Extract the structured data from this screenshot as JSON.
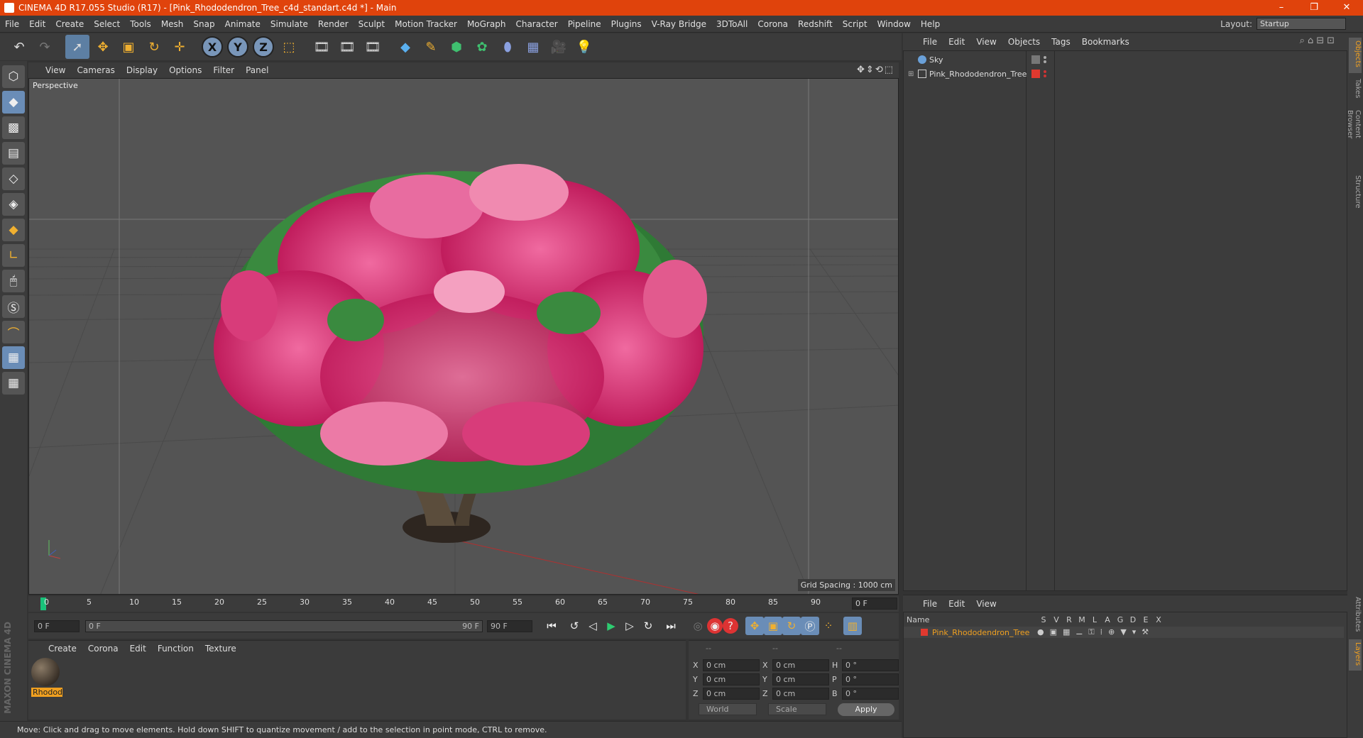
{
  "window": {
    "title": "CINEMA 4D R17.055 Studio (R17) - [Pink_Rhododendron_Tree_c4d_standart.c4d *] - Main",
    "buttons": [
      "–",
      "❐",
      "✕"
    ]
  },
  "menubar": {
    "items": [
      "File",
      "Edit",
      "Create",
      "Select",
      "Tools",
      "Mesh",
      "Snap",
      "Animate",
      "Simulate",
      "Render",
      "Sculpt",
      "Motion Tracker",
      "MoGraph",
      "Character",
      "Pipeline",
      "Plugins",
      "V-Ray Bridge",
      "3DToAll",
      "Corona",
      "Redshift",
      "Script",
      "Window",
      "Help"
    ],
    "layout_label": "Layout:",
    "layout_value": "Startup"
  },
  "toolbar": {
    "axis_x": "X",
    "axis_y": "Y",
    "axis_z": "Z",
    "icons": [
      "undo-icon",
      "redo-icon",
      "select-icon",
      "move-icon",
      "scale-icon",
      "rotate-icon",
      "last-tool-icon",
      "axis-x-icon",
      "axis-y-icon",
      "axis-z-icon",
      "coordinate-system-icon",
      "render-view-icon",
      "render-picture-viewer-icon",
      "edit-render-settings-icon",
      "cube-icon",
      "pen-icon",
      "subdivision-icon",
      "array-icon",
      "deformer-icon",
      "floor-icon",
      "camera-icon",
      "light-icon"
    ]
  },
  "viewport": {
    "menu": [
      "View",
      "Cameras",
      "Display",
      "Options",
      "Filter",
      "Panel"
    ],
    "label": "Perspective",
    "grid_spacing": "Grid Spacing : 1000 cm"
  },
  "timeline": {
    "ticks": [
      "0",
      "5",
      "10",
      "15",
      "20",
      "25",
      "30",
      "35",
      "40",
      "45",
      "50",
      "55",
      "60",
      "65",
      "70",
      "75",
      "80",
      "85",
      "90"
    ],
    "current_frame": "0 F",
    "start_field": "0 F",
    "range_start": "0 F",
    "range_end": "90 F",
    "end_field": "90 F"
  },
  "materials": {
    "menu": [
      "Create",
      "Corona",
      "Edit",
      "Function",
      "Texture"
    ],
    "items": [
      {
        "name": "Rhodod"
      }
    ]
  },
  "coordinates": {
    "headers": [
      "--",
      "--",
      "--"
    ],
    "rows": [
      {
        "a": "X",
        "av": "0 cm",
        "b": "X",
        "bv": "0 cm",
        "c": "H",
        "cv": "0 °"
      },
      {
        "a": "Y",
        "av": "0 cm",
        "b": "Y",
        "bv": "0 cm",
        "c": "P",
        "cv": "0 °"
      },
      {
        "a": "Z",
        "av": "0 cm",
        "b": "Z",
        "bv": "0 cm",
        "c": "B",
        "cv": "0 °"
      }
    ],
    "world": "World",
    "scale": "Scale",
    "apply": "Apply"
  },
  "status": "Move: Click and drag to move elements. Hold down SHIFT to quantize movement / add to the selection in point mode, CTRL to remove.",
  "objects": {
    "menu": [
      "File",
      "Edit",
      "View",
      "Objects",
      "Tags",
      "Bookmarks"
    ],
    "items": [
      {
        "name": "Sky",
        "color": "#6aa0d8"
      },
      {
        "name": "Pink_Rhododendron_Tree",
        "color": "#e0392f"
      }
    ]
  },
  "layers": {
    "menu": [
      "File",
      "Edit",
      "View"
    ],
    "header_name": "Name",
    "header_cols": [
      "S",
      "V",
      "R",
      "M",
      "L",
      "A",
      "G",
      "D",
      "E",
      "X"
    ],
    "items": [
      {
        "name": "Pink_Rhododendron_Tree",
        "color": "#e0392f"
      }
    ]
  },
  "side_tabs": [
    "Objects",
    "Takes",
    "Content Browser",
    "Structure",
    "Attributes",
    "Layers"
  ],
  "brand": "MAXON CINEMA 4D",
  "colors": {
    "titlebar": "#e0430c",
    "accent": "#f0a020",
    "panel": "#3b3b3b",
    "viewport": "#545454"
  }
}
